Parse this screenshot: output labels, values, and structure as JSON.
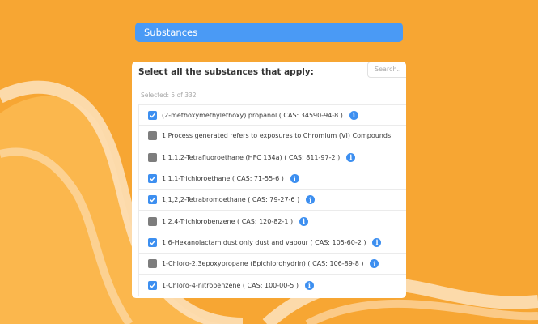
{
  "header": {
    "title": "Substances"
  },
  "panel": {
    "prompt": "Select all the substances that apply:",
    "search_placeholder": "Search..",
    "selected_text": "Selected: 5 of 332"
  },
  "items": [
    {
      "label": "(2-methoxymethylethoxy) propanol ( CAS: 34590-94-8 )",
      "checked": true,
      "info": true
    },
    {
      "label": "1 Process generated refers to exposures to Chromium (VI) Compounds",
      "checked": false,
      "info": false
    },
    {
      "label": "1,1,1,2-Tetrafluoroethane (HFC 134a) ( CAS: 811-97-2 )",
      "checked": false,
      "info": true
    },
    {
      "label": "1,1,1-Trichloroethane ( CAS: 71-55-6 )",
      "checked": true,
      "info": true
    },
    {
      "label": "1,1,2,2-Tetrabromoethane ( CAS: 79-27-6 )",
      "checked": true,
      "info": true
    },
    {
      "label": "1,2,4-Trichlorobenzene ( CAS: 120-82-1 )",
      "checked": false,
      "info": true
    },
    {
      "label": "1,6-Hexanolactam dust only dust and vapour ( CAS: 105-60-2 )",
      "checked": true,
      "info": true
    },
    {
      "label": "1-Chloro-2,3epoxypropane (Epichlorohydrin) ( CAS: 106-89-8 )",
      "checked": false,
      "info": true
    },
    {
      "label": "1-Chloro-4-nitrobenzene ( CAS: 100-00-5 )",
      "checked": true,
      "info": true
    }
  ],
  "icons": {
    "info": "info-icon",
    "check": "check-icon"
  },
  "colors": {
    "background": "#F7A633",
    "accent": "#4A9AF5",
    "checkbox_checked": "#3D8FF0",
    "checkbox_unchecked": "#7d7d7d"
  }
}
